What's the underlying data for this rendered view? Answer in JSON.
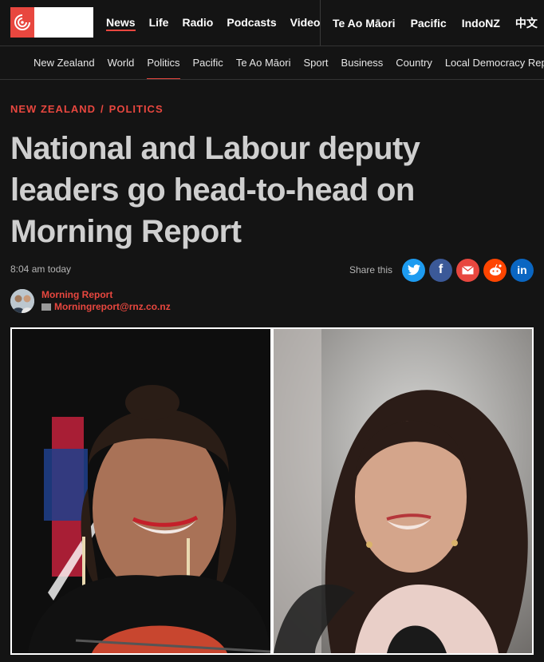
{
  "primary_nav": [
    "News",
    "Life",
    "Radio",
    "Podcasts",
    "Video"
  ],
  "secondary_nav": [
    "Te Ao Māori",
    "Pacific",
    "IndoNZ",
    "中文"
  ],
  "section_nav": [
    "New Zealand",
    "World",
    "Politics",
    "Pacific",
    "Te Ao Māori",
    "Sport",
    "Business",
    "Country",
    "Local Democracy Rep"
  ],
  "article": {
    "breadcrumb_1": "NEW ZEALAND",
    "breadcrumb_sep": "/",
    "breadcrumb_2": "POLITICS",
    "headline": "National and Labour deputy leaders go head-to-head on Morning Report",
    "date": "8:04 am today",
    "share_label": "Share this",
    "author_name": "Morning Report",
    "author_email": "Morningreport@rnz.co.nz"
  },
  "share_buttons": [
    {
      "name": "twitter-icon",
      "glyph": "🐦",
      "color": "#1d9bf0"
    },
    {
      "name": "facebook-icon",
      "glyph": "f",
      "color": "#3b5998"
    },
    {
      "name": "email-icon",
      "glyph": "✉",
      "color": "#e8473f"
    },
    {
      "name": "reddit-icon",
      "glyph": "☺",
      "color": "#ff4500"
    },
    {
      "name": "linkedin-icon",
      "glyph": "in",
      "color": "#0a66c2"
    }
  ],
  "colors": {
    "accent": "#e8473f",
    "background": "#141414"
  }
}
